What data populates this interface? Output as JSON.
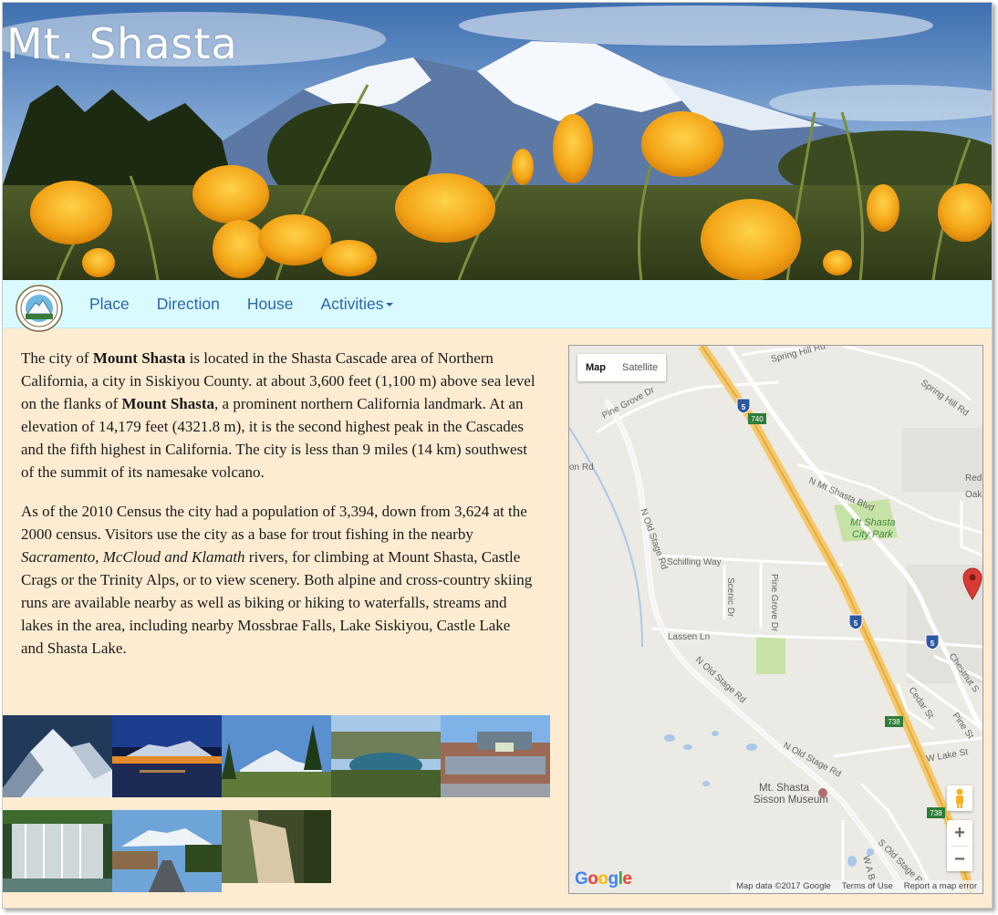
{
  "site": {
    "title": "Mt. Shasta"
  },
  "nav": {
    "logo": "city-seal-icon",
    "items": [
      {
        "label": "Place"
      },
      {
        "label": "Direction"
      },
      {
        "label": "House"
      },
      {
        "label": "Activities"
      }
    ]
  },
  "intro": {
    "p1": [
      {
        "t": "The city of "
      },
      {
        "t": "Mount Shasta",
        "b": true
      },
      {
        "t": " is located in the Shasta Cascade area of Northern California, a city in Siskiyou County. at about 3,600 feet (1,100 m) above sea level on the flanks of "
      },
      {
        "t": "Mount Shasta",
        "b": true
      },
      {
        "t": ", a prominent northern California landmark. At an elevation of 14,179 feet (4321.8 m), it is the second highest peak in the Cascades and the fifth highest in California. The city is less than 9 miles (14 km) southwest of the summit of its namesake volcano."
      }
    ],
    "p2": [
      {
        "t": "As of the 2010 Census the city had a population of 3,394, down from 3,624 at the 2000 census. Visitors use the city as a base for trout fishing in the nearby "
      },
      {
        "t": "Sacramento, McCloud and Klamath",
        "i": true
      },
      {
        "t": " rivers, for climbing at Mount Shasta, Castle Crags or the Trinity Alps, or to view scenery. Both alpine and cross-country skiing runs are available nearby as well as biking or hiking to waterfalls, streams and lakes in the area, including nearby Mossbrae Falls, Lake Siskiyou, Castle Lake and Shasta Lake."
      }
    ]
  },
  "gallery": [
    {
      "name": "snowy-peak-photo"
    },
    {
      "name": "night-lake-photo"
    },
    {
      "name": "pine-meadow-photo"
    },
    {
      "name": "mountain-lake-photo"
    },
    {
      "name": "storefront-photo"
    },
    {
      "name": "waterfall-photo"
    },
    {
      "name": "town-street-photo"
    },
    {
      "name": "creek-rocks-photo"
    }
  ],
  "map": {
    "type_buttons": {
      "map": "Map",
      "satellite": "Satellite"
    },
    "labels": {
      "spring_hill_rd": "Spring Hill Rd",
      "spring_hill_rd_2": "Spring Hill Rd",
      "pine_grove_dr": "Pine Grove Dr",
      "on_rd": "on Rd",
      "red": "Red",
      "oak": "Oak",
      "n_mt_shasta_blvd": "N Mt Shasta Blvd",
      "park_1": "Mt Shasta",
      "park_2": "City Park",
      "n_old_stage_rd": "N Old Stage Rd",
      "schilling_way": "Schilling Way",
      "scenic_dr": "Scenic Dr",
      "pine_grove_dr_2": "Pine Grove Dr",
      "lassen_ln": "Lassen Ln",
      "n_old_stage_rd_2": "N Old Stage Rd",
      "chestnut": "Chestnut S",
      "cedar_st": "Cedar St",
      "pine_st": "Pine St",
      "n_old_stage_rd_3": "N Old Stage Rd",
      "w_lake_st": "W Lake St",
      "museum_1": "Mt. Shasta",
      "museum_2": "Sisson Museum",
      "s_old_stage_rd": "S Old Stage R",
      "w_a_bar": "W A Bar",
      "i5_a": "5",
      "i5_b": "5",
      "i5_c": "5",
      "exit_740": "740",
      "exit_738": "738",
      "exit_738_b": "738"
    },
    "zoom_in": "+",
    "zoom_out": "−",
    "google": "Google",
    "attribution": {
      "data": "Map data ©2017 Google",
      "terms": "Terms of Use",
      "report": "Report a map error"
    }
  }
}
